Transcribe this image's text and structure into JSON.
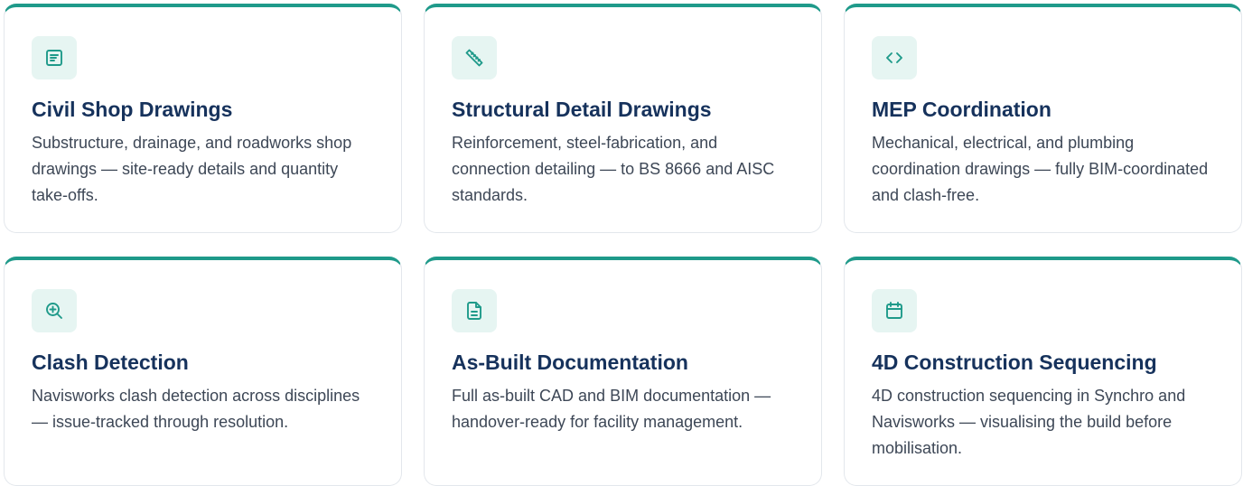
{
  "colors": {
    "accent": "#1f9a8a",
    "icon_bg": "#e6f5f2",
    "title": "#16325c",
    "text": "#3d4756"
  },
  "cards": [
    {
      "icon": "document-text-icon",
      "title": "Civil Shop Drawings",
      "description": "Substructure, drainage, and roadworks shop drawings — site-ready details and quantity take-offs."
    },
    {
      "icon": "ruler-icon",
      "title": "Structural Detail Drawings",
      "description": "Reinforcement, steel-fabrication, and connection detailing — to BS 8666 and AISC standards."
    },
    {
      "icon": "code-brackets-icon",
      "title": "MEP Coordination",
      "description": "Mechanical, electrical, and plumbing coordination drawings — fully BIM-coordinated and clash-free."
    },
    {
      "icon": "zoom-in-icon",
      "title": "Clash Detection",
      "description": "Navisworks clash detection across disciplines — issue-tracked through resolution."
    },
    {
      "icon": "file-text-icon",
      "title": "As-Built Documentation",
      "description": "Full as-built CAD and BIM documentation — handover-ready for facility management."
    },
    {
      "icon": "calendar-icon",
      "title": "4D Construction Sequencing",
      "description": "4D construction sequencing in Synchro and Navisworks — visualising the build before mobilisation."
    }
  ]
}
